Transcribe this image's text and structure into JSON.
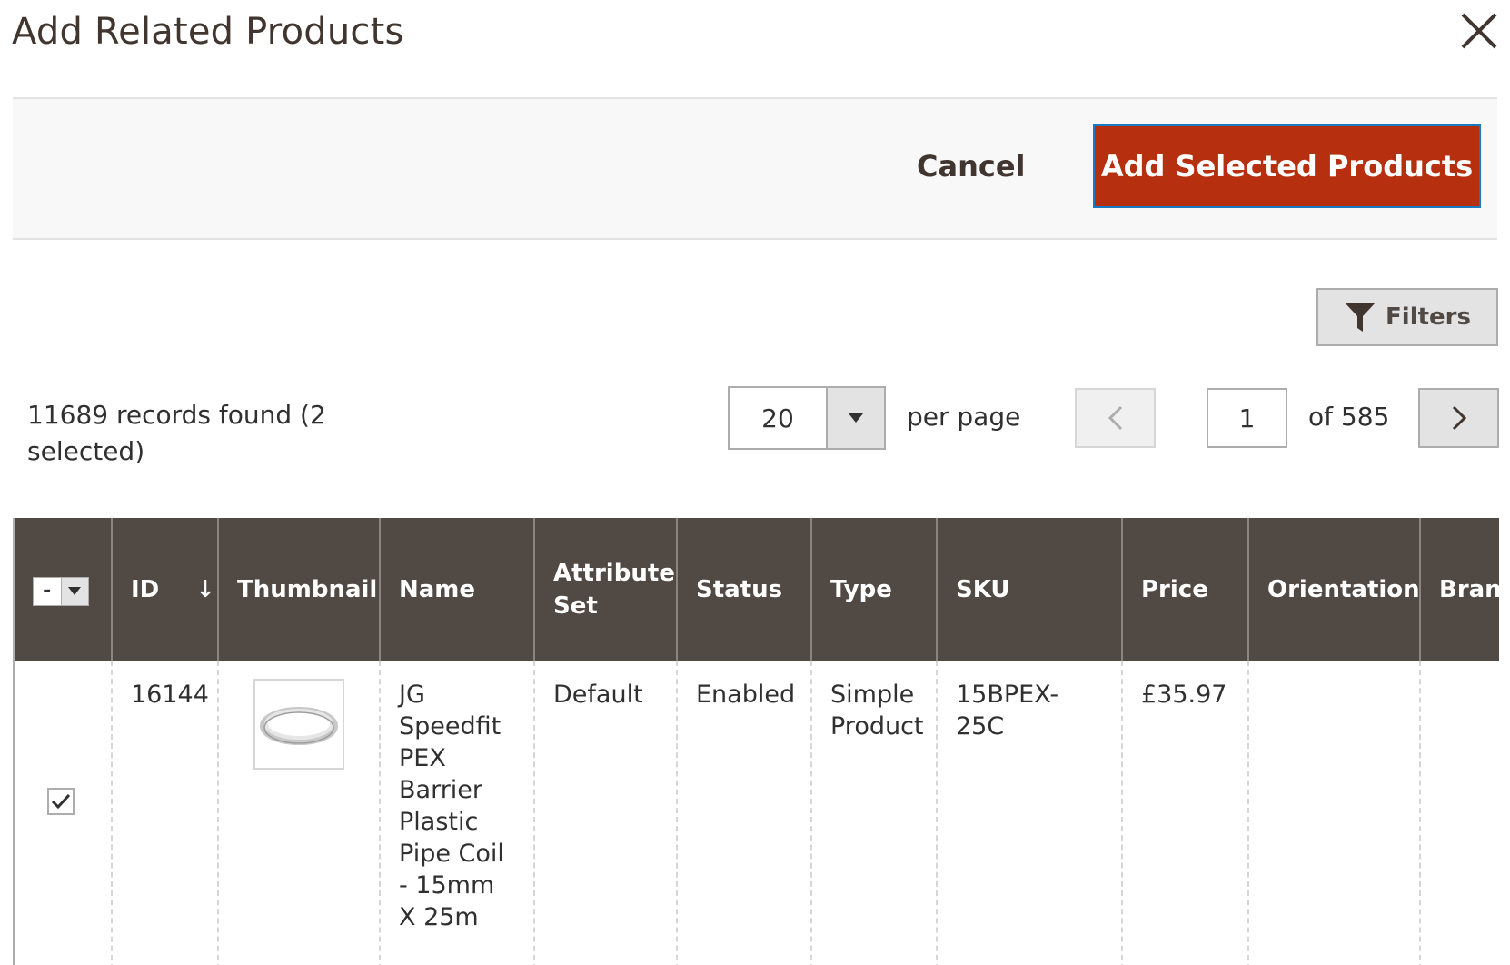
{
  "modal": {
    "title": "Add Related Products",
    "close_icon": "close-icon"
  },
  "actions": {
    "cancel_label": "Cancel",
    "add_label": "Add Selected Products",
    "add_color": "#b6300f"
  },
  "toolbar": {
    "filters_label": "Filters",
    "filters_icon": "funnel-icon",
    "records_text": "11689 records found (2 selected)",
    "per_page_value": "20",
    "per_page_label": "per page",
    "current_page": "1",
    "total_pages_text": "of 585"
  },
  "grid": {
    "header_color": "#514943",
    "columns": {
      "id": "ID",
      "sort_arrow": "↓",
      "thumbnail": "Thumbnail",
      "name": "Name",
      "attribute_set": "Attribute Set",
      "status": "Status",
      "type": "Type",
      "sku": "SKU",
      "price": "Price",
      "orientation": "Orientation",
      "brand": "Brand"
    },
    "mass_select_symbol": "-",
    "rows": [
      {
        "checked": true,
        "id": "16144",
        "thumbnail_icon": "pipe-coil-icon",
        "name": "JG Speedfit PEX Barrier Plastic Pipe Coil - 15mm X 25m",
        "attribute_set": "Default",
        "status": "Enabled",
        "type": "Simple Product",
        "sku": "15BPEX-25C",
        "price": "£35.97",
        "orientation": "",
        "brand": ""
      }
    ]
  }
}
